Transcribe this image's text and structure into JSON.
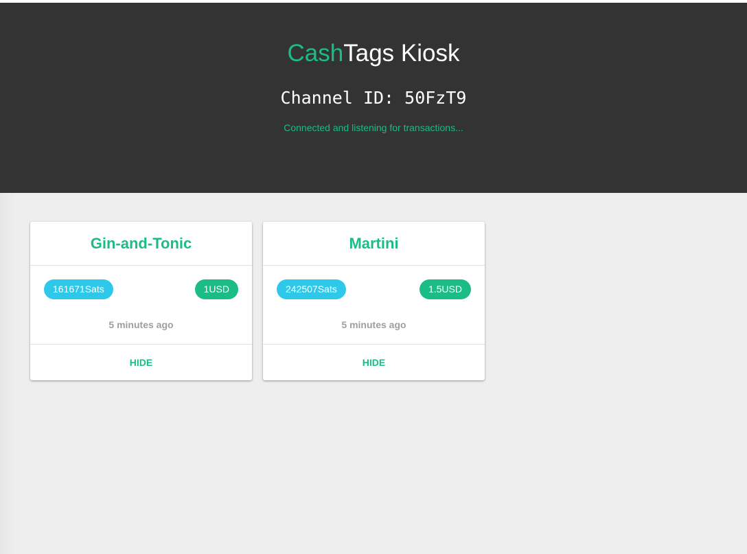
{
  "header": {
    "title_accent": "Cash",
    "title_rest": "Tags Kiosk",
    "channel_id": "Channel ID: 50FzT9",
    "status": "Connected and listening for transactions..."
  },
  "cards": [
    {
      "title": "Gin-and-Tonic",
      "sats": "161671Sats",
      "usd": "1USD",
      "time": "5 minutes ago",
      "hide_label": "HIDE"
    },
    {
      "title": "Martini",
      "sats": "242507Sats",
      "usd": "1.5USD",
      "time": "5 minutes ago",
      "hide_label": "HIDE"
    }
  ],
  "colors": {
    "accent": "#1bbc86",
    "sats_chip": "#2ec9ea",
    "header_bg": "#333333",
    "content_bg": "#eeeeee"
  }
}
